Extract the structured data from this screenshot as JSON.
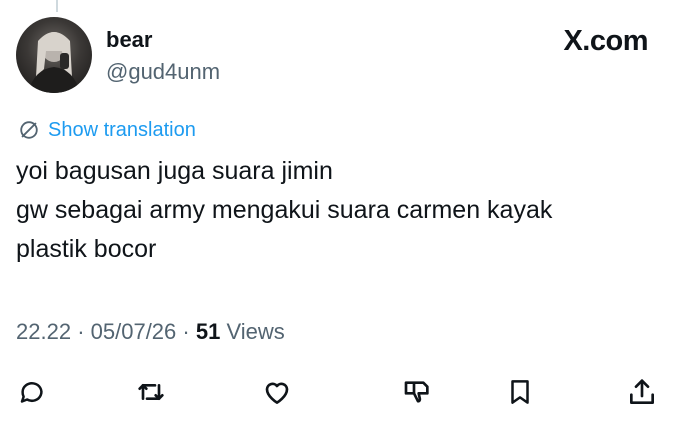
{
  "tweet": {
    "author": {
      "display_name": "bear",
      "handle": "@gud4unm"
    },
    "brand": "X.com",
    "translate_label": "Show translation",
    "text_lines": [
      "yoi bagusan juga suara jimin",
      "gw sebagai army mengakui suara carmen kayak",
      "plastik bocor"
    ],
    "meta": {
      "time": "22.22",
      "separator": "·",
      "date": "05/07/26",
      "views_count": "51",
      "views_label": "Views"
    }
  },
  "actions": [
    {
      "name": "reply",
      "icon": "reply-icon"
    },
    {
      "name": "retweet",
      "icon": "retweet-icon"
    },
    {
      "name": "like",
      "icon": "heart-icon"
    },
    {
      "name": "dislike",
      "icon": "thumbs-down-icon"
    },
    {
      "name": "bookmark",
      "icon": "bookmark-icon"
    },
    {
      "name": "share",
      "icon": "share-icon"
    }
  ],
  "colors": {
    "text": "#0f1419",
    "secondary": "#536471",
    "link": "#1d9bf0",
    "background": "#ffffff"
  }
}
